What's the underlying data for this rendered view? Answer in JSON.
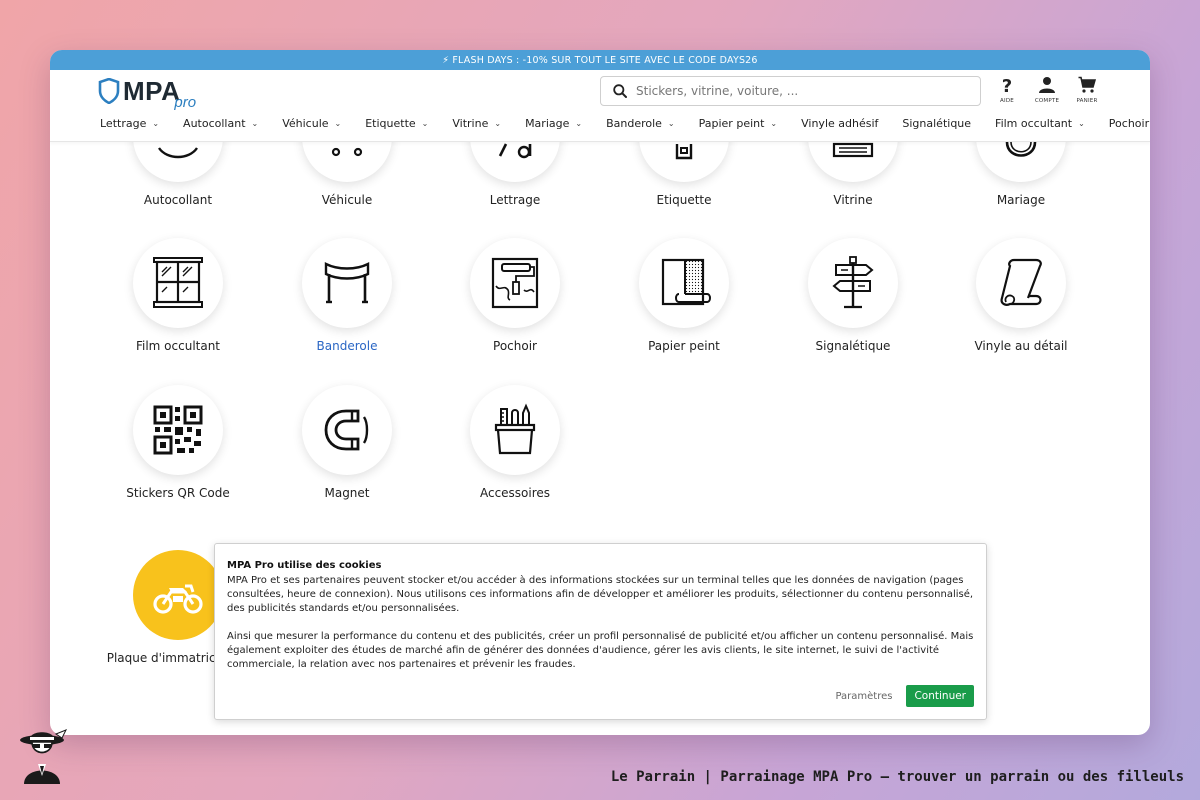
{
  "flash_banner": "⚡ FLASH DAYS : -10% SUR TOUT LE SITE AVEC LE CODE DAYS26",
  "logo": {
    "brand": "MPA",
    "suffix": "pro"
  },
  "search": {
    "placeholder": "Stickers, vitrine, voiture, ..."
  },
  "header_icons": {
    "help": "AIDE",
    "account": "COMPTE",
    "cart": "PANIER"
  },
  "nav": [
    {
      "label": "Lettrage",
      "dropdown": true
    },
    {
      "label": "Autocollant",
      "dropdown": true
    },
    {
      "label": "Véhicule",
      "dropdown": true
    },
    {
      "label": "Etiquette",
      "dropdown": true
    },
    {
      "label": "Vitrine",
      "dropdown": true
    },
    {
      "label": "Mariage",
      "dropdown": true
    },
    {
      "label": "Banderole",
      "dropdown": true
    },
    {
      "label": "Papier peint",
      "dropdown": true
    },
    {
      "label": "Vinyle adhésif",
      "dropdown": false
    },
    {
      "label": "Signalétique",
      "dropdown": false
    },
    {
      "label": "Film occultant",
      "dropdown": true
    },
    {
      "label": "Pochoir",
      "dropdown": false
    }
  ],
  "categories": {
    "row1": [
      "Autocollant",
      "Véhicule",
      "Lettrage",
      "Etiquette",
      "Vitrine",
      "Mariage"
    ],
    "row2": [
      "Film occultant",
      "Banderole",
      "Pochoir",
      "Papier peint",
      "Signalétique",
      "Vinyle au détail"
    ],
    "row3": [
      "Stickers QR Code",
      "Magnet",
      "Accessoires"
    ],
    "row4": [
      "Plaque d'immatriculatio"
    ]
  },
  "active_category": "Banderole",
  "cookie": {
    "title": "MPA Pro utilise des cookies",
    "p1": "MPA Pro et ses partenaires peuvent stocker et/ou accéder à des informations stockées sur un terminal telles que les données de navigation (pages consultées, heure de connexion). Nous utilisons ces informations afin de développer et améliorer les produits, sélectionner du contenu personnalisé, des publicités standards et/ou personnalisées.",
    "p2": "Ainsi que mesurer la performance du contenu et des publicités, créer un profil personnalisé de publicité et/ou afficher un contenu personnalisé. Mais également exploiter des études de marché afin de générer des données d'audience, gérer les avis clients, le site internet, le suivi de l'activité commerciale, la relation avec nos partenaires et prévenir les fraudes.",
    "settings_label": "Paramètres",
    "continue_label": "Continuer"
  },
  "caption": "Le Parrain | Parrainage MPA Pro — trouver un parrain ou des filleuls",
  "colors": {
    "flash": "#4c9fd7",
    "accent_blue": "#2a66c4",
    "continue_green": "#1a9c4a",
    "plaque_yellow": "#f8c21c"
  }
}
